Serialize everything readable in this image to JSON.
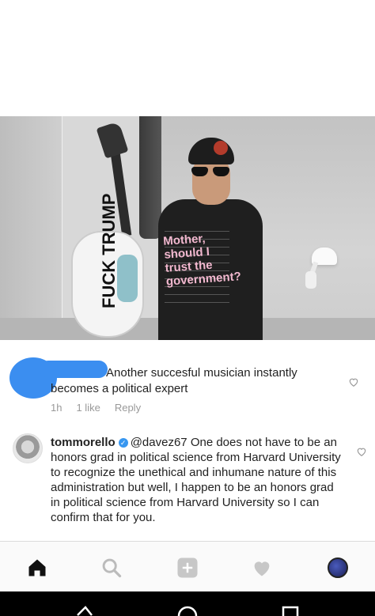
{
  "photo": {
    "guitar_text": "FUCK TRUMP",
    "shirt_text": "Mother, should I trust the government?"
  },
  "comment1": {
    "text_line1": "Another succesful musician instantly",
    "text_line2": "becomes a political expert",
    "time": "1h",
    "likes": "1 like",
    "reply": "Reply"
  },
  "comment2": {
    "username": "tommorello",
    "mention": "@davez67",
    "text": "One does not have to be an honors grad in political science from Harvard University to recognize the unethical and inhumane nature of this administration but well, I happen to be an honors grad in political science from Harvard University so I can confirm that for you."
  },
  "nav": {
    "icons": [
      "home-icon",
      "search-icon",
      "add-icon",
      "heart-icon",
      "profile-avatar"
    ]
  },
  "colors": {
    "blue_redaction": "#3b8ef0",
    "verified": "#3897f0",
    "muted": "#999999"
  }
}
